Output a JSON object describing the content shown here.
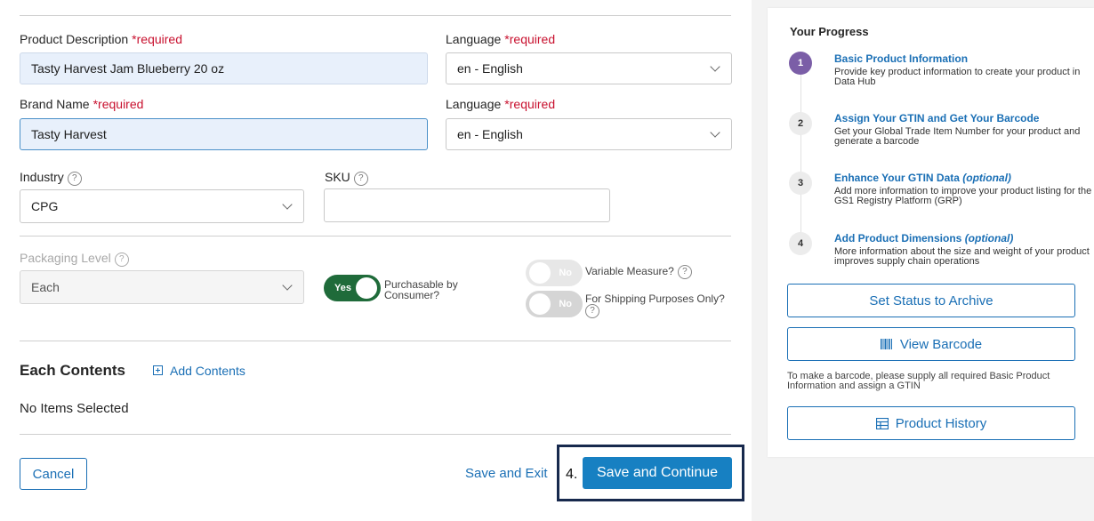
{
  "form": {
    "product_description": {
      "label": "Product Description",
      "required": "*required",
      "value": "Tasty Harvest Jam Blueberry 20 oz"
    },
    "language1": {
      "label": "Language",
      "required": "*required",
      "value": "en - English"
    },
    "brand_name": {
      "label": "Brand Name",
      "required": "*required",
      "value": "Tasty Harvest"
    },
    "language2": {
      "label": "Language",
      "required": "*required",
      "value": "en - English"
    },
    "industry": {
      "label": "Industry",
      "value": "CPG"
    },
    "sku": {
      "label": "SKU",
      "value": ""
    },
    "packaging_level": {
      "label": "Packaging Level",
      "value": "Each"
    },
    "purchasable": {
      "toggle": "Yes",
      "label": "Purchasable by Consumer?"
    },
    "variable_measure": {
      "toggle": "No",
      "label": "Variable Measure?"
    },
    "shipping_only": {
      "toggle": "No",
      "label": "For Shipping Purposes Only?"
    }
  },
  "contents": {
    "title": "Each Contents",
    "add_label": "Add Contents",
    "empty_text": "No Items Selected"
  },
  "footer": {
    "cancel": "Cancel",
    "save_exit": "Save and Exit",
    "step_annotation": "4.",
    "save_continue": "Save and Continue"
  },
  "progress": {
    "title": "Your Progress",
    "steps": [
      {
        "num": "1",
        "title": "Basic Product Information",
        "optional": "",
        "desc": "Provide key product information to create your product in Data Hub"
      },
      {
        "num": "2",
        "title": "Assign Your GTIN and Get Your Barcode",
        "optional": "",
        "desc": "Get your Global Trade Item Number for your product and generate a barcode"
      },
      {
        "num": "3",
        "title": "Enhance Your GTIN Data",
        "optional": "(optional)",
        "desc": "Add more information to improve your product listing for the GS1 Registry Platform (GRP)"
      },
      {
        "num": "4",
        "title": "Add Product Dimensions",
        "optional": "(optional)",
        "desc": "More information about the size and weight of your product improves supply chain operations"
      }
    ],
    "archive_btn": "Set Status to Archive",
    "barcode_btn": "View Barcode",
    "barcode_note": "To make a barcode, please supply all required Basic Product Information and assign a GTIN",
    "history_btn": "Product History"
  },
  "icons": {
    "help": "help-circle-icon",
    "chevron": "chevron-down-icon",
    "add": "plus-square-icon",
    "barcode": "barcode-icon",
    "history": "table-icon"
  },
  "colors": {
    "accent": "#1a6fb5",
    "primary_button": "#1780c2",
    "required": "#c8102e",
    "toggle_on": "#1f6b3a",
    "step_active": "#7b5ea7"
  }
}
